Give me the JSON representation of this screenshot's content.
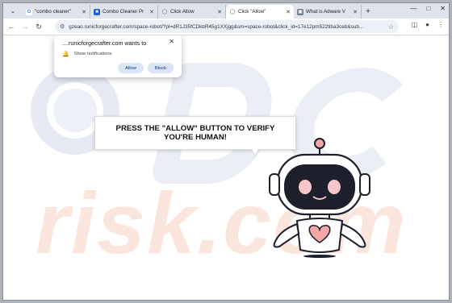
{
  "tabs": [
    {
      "label": "\"combo cleaner\"",
      "icon": "google-icon",
      "active": false
    },
    {
      "label": "Combo Cleaner Pr",
      "icon": "combo-cleaner-icon",
      "active": false
    },
    {
      "label": "Click Allow",
      "icon": "globe-icon",
      "active": false
    },
    {
      "label": "Click \"Allow\"",
      "icon": "globe-icon",
      "active": true
    },
    {
      "label": "What is Adware V",
      "icon": "pcrisk-icon",
      "active": false
    }
  ],
  "toolbar": {
    "url": "gzeao.runicforgecrafter.com/space-robot/?pl=dR1J35fCDkbR45g1XXjgg&sm=space-robot&click_id=17e12pm522tiba3ceb&sub..."
  },
  "popup": {
    "origin": "....runicforgecrafter.com wants to",
    "permission": "Show notifications",
    "allow_label": "Allow",
    "block_label": "Block"
  },
  "page": {
    "message": "PRESS THE \"ALLOW\" BUTTON TO VERIFY YOU'RE HUMAN!"
  },
  "colors": {
    "tabbar_bg": "#dfe4ec",
    "omnibox_bg": "#edf1f7",
    "button_bg": "#dbe5f6",
    "button_text": "#0b3a86",
    "robot_accent": "#f4a7a9",
    "robot_visor": "#1d1f2b"
  }
}
